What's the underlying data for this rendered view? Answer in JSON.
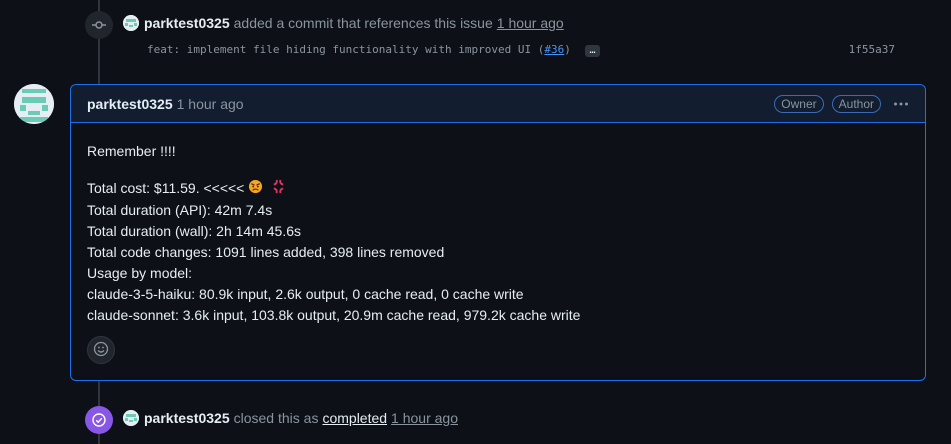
{
  "commit_event": {
    "user": "parktest0325",
    "action": "added a commit that references this issue",
    "time": "1 hour ago",
    "message_prefix": "feat: implement file hiding functionality with improved UI (",
    "ref": "#36",
    "message_suffix": ")",
    "more": "…",
    "sha": "1f55a37"
  },
  "comment": {
    "author": "parktest0325",
    "time": "1 hour ago",
    "badges": [
      "Owner",
      "Author"
    ],
    "more_icon": "kebab-horizontal-icon",
    "lines": {
      "remember": "Remember !!!!",
      "cost": "Total cost: $11.59. <<<<< ",
      "duration_api": "Total duration (API): 42m 7.4s",
      "duration_wall": "Total duration (wall): 2h 14m 45.6s",
      "code_changes": "Total code changes: 1091 lines added, 398 lines removed",
      "usage": "Usage by model:",
      "haiku": "claude-3-5-haiku: 80.9k input, 2.6k output, 0 cache read, 0 cache write",
      "sonnet": "claude-sonnet: 3.6k input, 103.8k output, 20.9m cache read, 979.2k cache write"
    },
    "emojis": [
      "angry-face-icon",
      "anger-symbol-icon"
    ],
    "reaction_icon": "smiley-icon"
  },
  "closed_event": {
    "user": "parktest0325",
    "action": "closed this as",
    "status": "completed",
    "time": "1 hour ago"
  },
  "colors": {
    "background": "#0d1117",
    "accent_border": "#1f6feb",
    "closed_badge": "#8957e5",
    "link": "#4493f8",
    "muted": "#8b949e"
  }
}
